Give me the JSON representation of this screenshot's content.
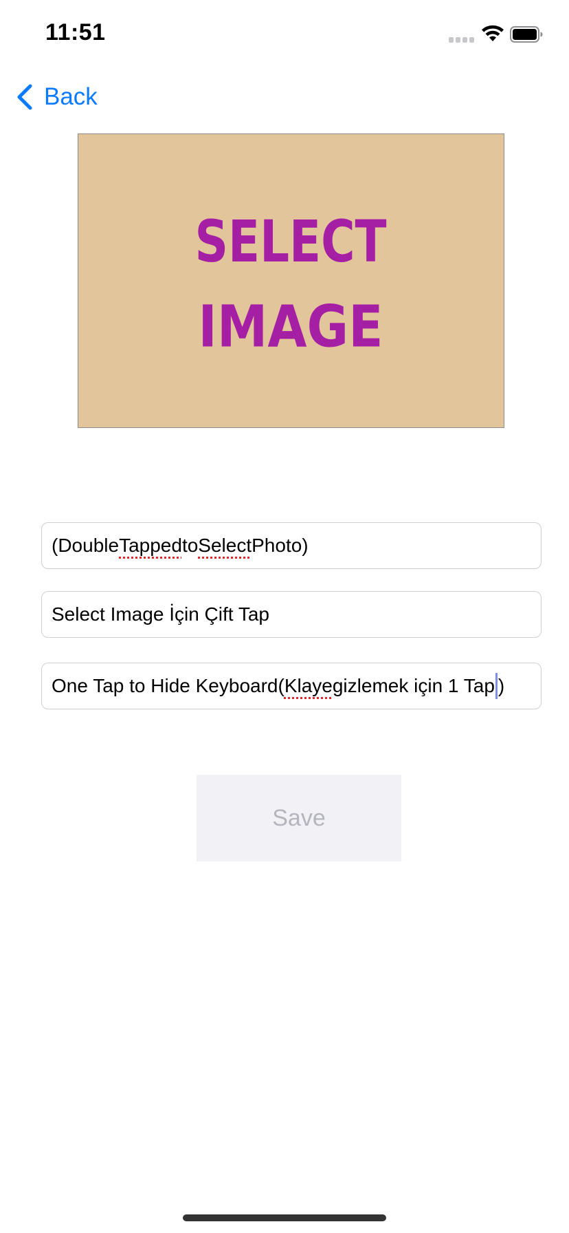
{
  "status_bar": {
    "time": "11:51"
  },
  "nav": {
    "back_label": "Back",
    "back_icon": "chevron-left-icon"
  },
  "image_picker": {
    "line1": "SELECT",
    "line2": "IMAGE",
    "background_color": "#e3c59b",
    "text_color": "#a51fa5"
  },
  "fields": [
    {
      "segments": [
        "(Double ",
        "Tapped",
        " to ",
        "Select",
        " Photo)"
      ]
    },
    {
      "value": "Select Image İçin Çift Tap"
    },
    {
      "before": "One Tap to Hide Keyboard(",
      "misspelled": "Klaye",
      "middle": " gizlemek için 1 Tap",
      "after_caret": ")"
    }
  ],
  "save_button": {
    "label": "Save",
    "enabled": false
  },
  "colors": {
    "accent": "#0a7aff",
    "spellcheck": "#e0252b"
  }
}
